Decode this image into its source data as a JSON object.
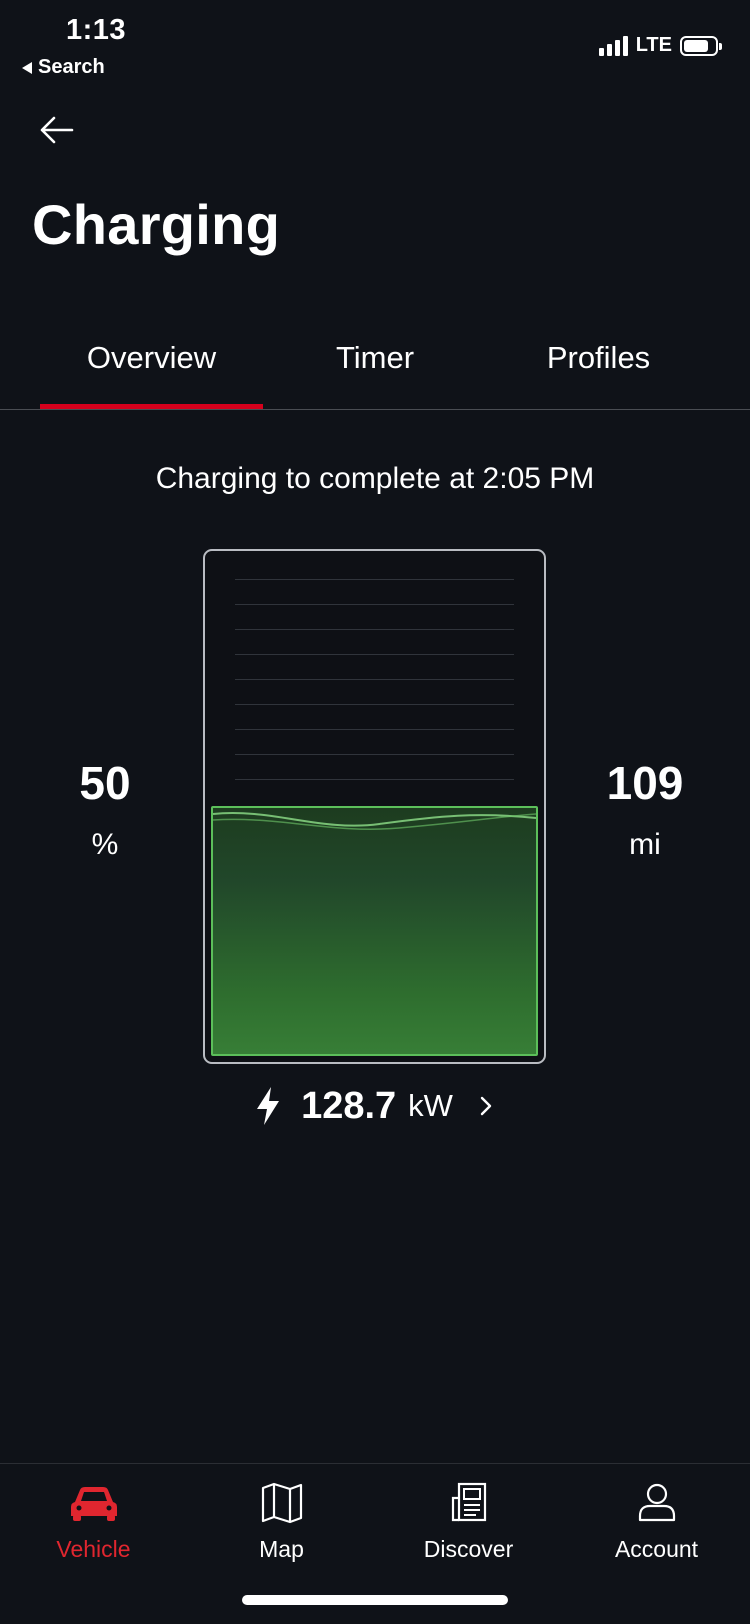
{
  "status_bar": {
    "time": "1:13",
    "back_label": "Search",
    "network": "LTE",
    "signal_bars": 4,
    "battery_level": 0.8
  },
  "header": {
    "title": "Charging"
  },
  "tabs": [
    {
      "label": "Overview",
      "active": true
    },
    {
      "label": "Timer",
      "active": false
    },
    {
      "label": "Profiles",
      "active": false
    }
  ],
  "overview": {
    "message": "Charging to complete at 2:05 PM",
    "charge_level": {
      "value": "50",
      "unit": "%",
      "fill_fraction": 0.5
    },
    "range": {
      "value": "109",
      "unit": "mi"
    },
    "power": {
      "value": "128.7",
      "unit": "kW"
    }
  },
  "bottom_nav": [
    {
      "label": "Vehicle",
      "icon": "car-icon",
      "active": true
    },
    {
      "label": "Map",
      "icon": "map-icon",
      "active": false
    },
    {
      "label": "Discover",
      "icon": "newspaper-icon",
      "active": false
    },
    {
      "label": "Account",
      "icon": "person-icon",
      "active": false
    }
  ],
  "colors": {
    "background": "#0f1218",
    "accent": "#d5001c",
    "charge_fill": "#377e36",
    "charge_border": "#5cbf5a"
  }
}
